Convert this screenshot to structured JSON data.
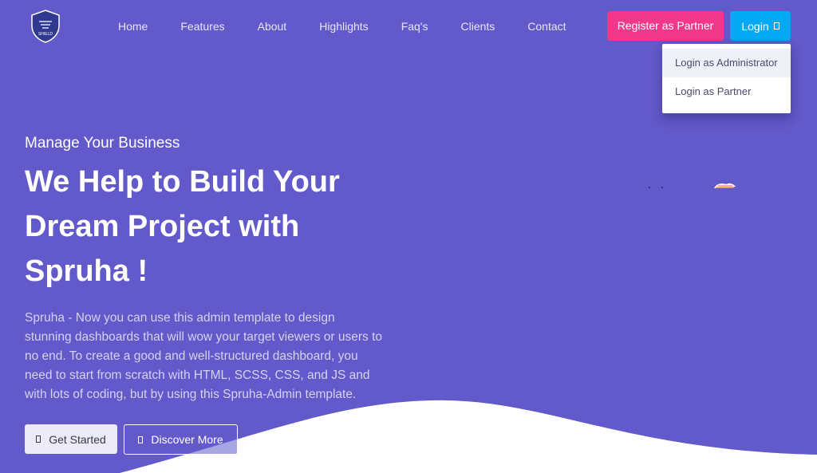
{
  "brand": {
    "logo_text": "SHIELD",
    "logo_icon": "shield-logo-icon"
  },
  "nav": {
    "items": [
      {
        "label": "Home"
      },
      {
        "label": "Features"
      },
      {
        "label": "About"
      },
      {
        "label": "Highlights"
      },
      {
        "label": "Faq's"
      },
      {
        "label": "Clients"
      },
      {
        "label": "Contact"
      }
    ]
  },
  "header_actions": {
    "register_label": "Register as Partner",
    "login_label": "Login",
    "login_icon": "caret-box-icon"
  },
  "login_dropdown": {
    "items": [
      {
        "label": "Login as Administrator"
      },
      {
        "label": "Login as Partner"
      }
    ]
  },
  "hero": {
    "subtitle": "Manage Your Business",
    "title_lines": [
      "We Help to Build Your",
      "Dream Project with",
      "Spruha !"
    ],
    "description_lines": [
      "Spruha - Now you can use this admin template to design",
      "stunning dashboards that will wow your target viewers or users to",
      "no end. To create a good and well-structured dashboard, you",
      "need to start from scratch with HTML, SCSS, CSS, and JS and",
      "with lots of coding, but by using this Spruha-Admin template."
    ],
    "get_started_label": "Get Started",
    "discover_label": "Discover More"
  },
  "colors": {
    "background": "#6259ca",
    "register": "#f1388b",
    "login": "#03a9f4"
  }
}
